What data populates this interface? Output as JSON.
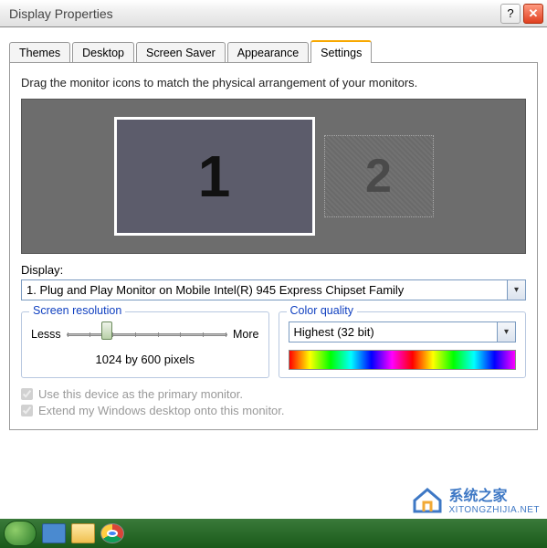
{
  "window": {
    "title": "Display Properties"
  },
  "tabs": {
    "items": [
      "Themes",
      "Desktop",
      "Screen Saver",
      "Appearance",
      "Settings"
    ],
    "active_index": 4
  },
  "settings": {
    "instruction": "Drag the monitor icons to match the physical arrangement of your monitors.",
    "monitors": {
      "primary_label": "1",
      "secondary_label": "2"
    },
    "display_label": "Display:",
    "display_value": "1. Plug and Play Monitor on Mobile Intel(R) 945 Express Chipset Family",
    "resolution": {
      "legend": "Screen resolution",
      "less_label": "Lesss",
      "more_label": "More",
      "value_text": "1024 by 600 pixels"
    },
    "color": {
      "legend": "Color quality",
      "value": "Highest (32 bit)"
    },
    "checks": {
      "primary": "Use this device as the primary monitor.",
      "extend": "Extend my Windows desktop onto this monitor."
    }
  },
  "watermark": {
    "line1": "系统之家",
    "line2": "XITONGZHIJIA.NET"
  }
}
